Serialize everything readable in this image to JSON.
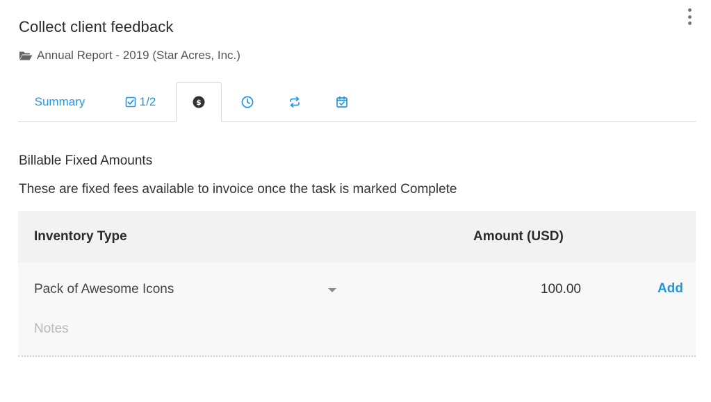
{
  "header": {
    "title": "Collect client feedback",
    "more_icon": "more-vertical-icon"
  },
  "breadcrumb": {
    "icon": "folder-open-icon",
    "text": "Annual Report - 2019 (Star Acres, Inc.)"
  },
  "tabs": [
    {
      "label": "Summary",
      "icon": null
    },
    {
      "label": "1/2",
      "icon": "checkbox-icon"
    },
    {
      "label": "",
      "icon": "dollar-circle-icon",
      "active": true
    },
    {
      "label": "",
      "icon": "clock-icon"
    },
    {
      "label": "",
      "icon": "repeat-icon"
    },
    {
      "label": "",
      "icon": "calendar-check-icon"
    }
  ],
  "billing": {
    "title": "Billable Fixed Amounts",
    "description": "These are fixed fees available to invoice once the task is marked Complete",
    "columns": {
      "type": "Inventory Type",
      "amount": "Amount (USD)"
    },
    "row": {
      "inventory_type": "Pack of Awesome Icons",
      "amount": "100.00",
      "add_label": "Add",
      "notes_placeholder": "Notes"
    }
  },
  "colors": {
    "accent": "#2196e3",
    "header_bg": "#f2f2f2",
    "row_bg": "#f8f8f8"
  }
}
